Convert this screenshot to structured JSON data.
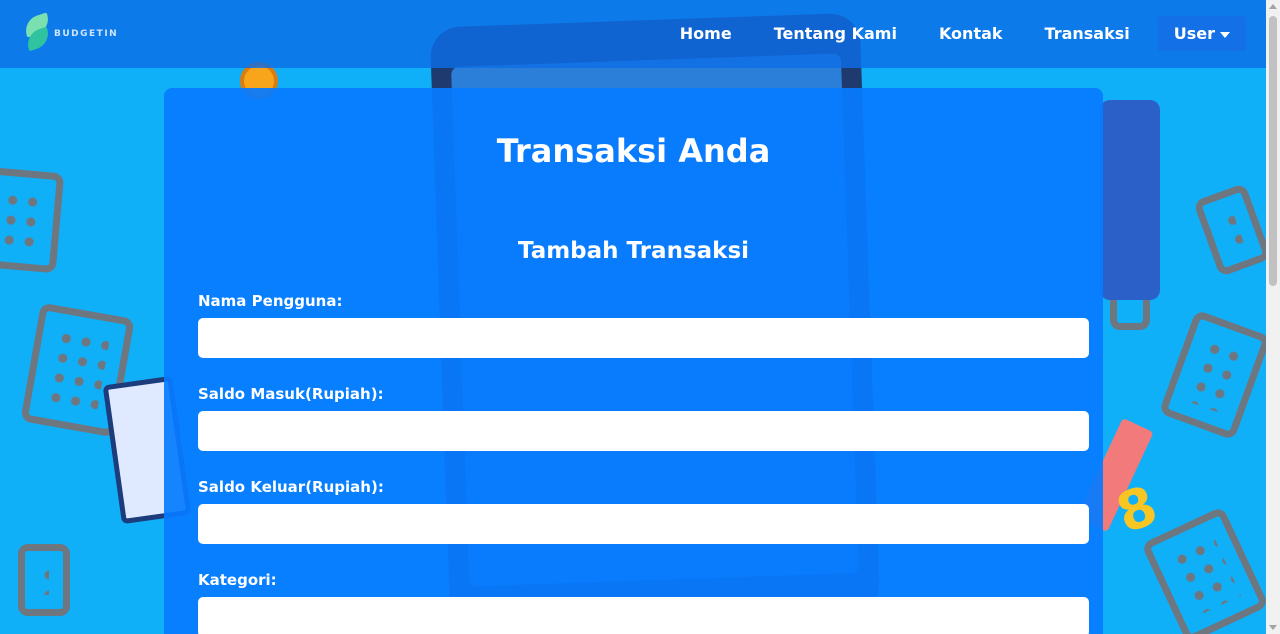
{
  "brand": {
    "name": "BUDGETIN"
  },
  "nav": {
    "links": [
      "Home",
      "Tentang Kami",
      "Kontak",
      "Transaksi"
    ],
    "user_label": "User"
  },
  "card": {
    "title": "Transaksi Anda",
    "subtitle": "Tambah Transaksi",
    "fields": [
      {
        "label": "Nama Pengguna:",
        "value": ""
      },
      {
        "label": "Saldo Masuk(Rupiah):",
        "value": ""
      },
      {
        "label": "Saldo Keluar(Rupiah):",
        "value": ""
      },
      {
        "label": "Kategori:",
        "value": ""
      }
    ]
  },
  "colors": {
    "navbar": "#0e6ee6",
    "card": "#067bff",
    "background": "#10b0f8",
    "input": "#ffffff"
  },
  "icons": [
    "budgetin-logo-icon",
    "caret-down-icon"
  ]
}
